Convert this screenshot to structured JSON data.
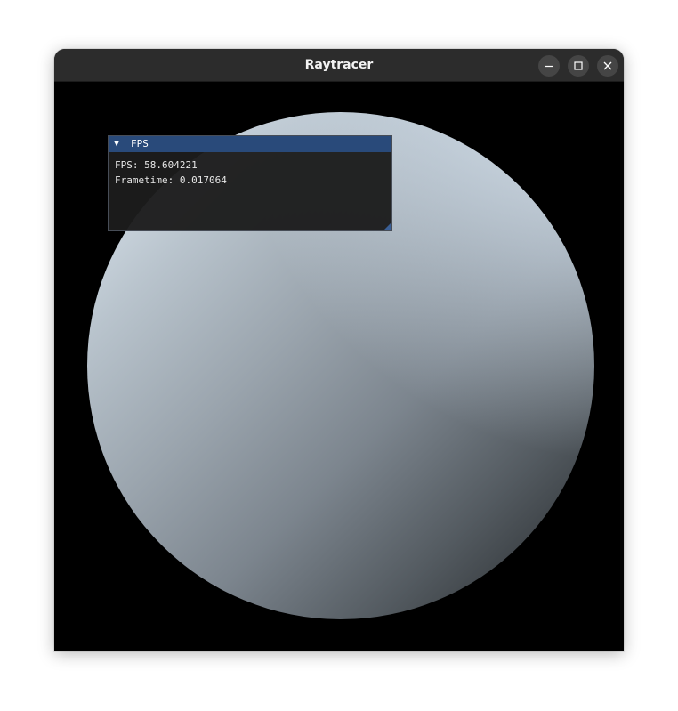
{
  "window": {
    "title": "Raytracer",
    "controls": {
      "minimize_icon": "minimize-icon",
      "maximize_icon": "maximize-icon",
      "close_icon": "close-icon"
    }
  },
  "overlay": {
    "title": "FPS",
    "collapse_glyph": "▼",
    "fps_text": "FPS: 58.604221",
    "frametime_text": "Frametime: 0.017064"
  },
  "colors": {
    "titlebar": "#2c2c2c",
    "overlay_header": "#294a7a",
    "background": "#000000"
  }
}
